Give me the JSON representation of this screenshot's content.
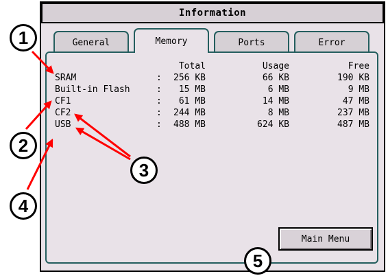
{
  "window": {
    "title": "Information"
  },
  "tabs": [
    {
      "label": "General",
      "active": false
    },
    {
      "label": "Memory",
      "active": true
    },
    {
      "label": "Ports",
      "active": false
    },
    {
      "label": "Error",
      "active": false
    }
  ],
  "table": {
    "headers": {
      "total": "Total",
      "usage": "Usage",
      "free": "Free"
    },
    "rows": [
      {
        "name": "SRAM",
        "sep": ":",
        "total": "256 KB",
        "usage": "66 KB",
        "free": "190 KB"
      },
      {
        "name": "Built-in Flash",
        "sep": ":",
        "total": "15 MB",
        "usage": "6 MB",
        "free": "9 MB"
      },
      {
        "name": "CF1",
        "sep": ":",
        "total": "61 MB",
        "usage": "14 MB",
        "free": "47 MB"
      },
      {
        "name": "CF2",
        "sep": ":",
        "total": "244 MB",
        "usage": "8 MB",
        "free": "237 MB"
      },
      {
        "name": "USB",
        "sep": ":",
        "total": "488 MB",
        "usage": "624 KB",
        "free": "487 MB"
      }
    ]
  },
  "buttons": {
    "main_menu": "Main Menu"
  },
  "callouts": [
    "1",
    "2",
    "3",
    "4",
    "5"
  ],
  "colors": {
    "arrow": "#ff0000",
    "panel_border": "#245e5e",
    "background": "#e9e2e8"
  }
}
